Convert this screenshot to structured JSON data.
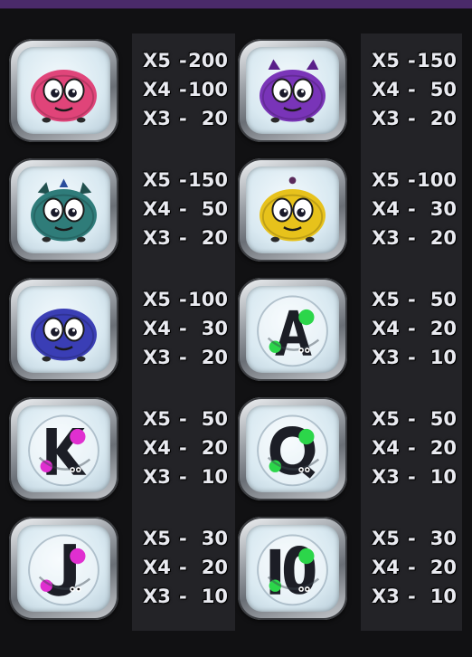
{
  "colors": {
    "background": "#111113",
    "column": "#232327",
    "topbar": "#4a2a6a",
    "text": "#e9eaf0"
  },
  "paytable": [
    {
      "symbol": "pink-monster-icon",
      "color": "#e0457a",
      "rows": [
        {
          "mult": "X5",
          "dash": "-",
          "value": "200"
        },
        {
          "mult": "X4",
          "dash": "-",
          "value": "100"
        },
        {
          "mult": "X3",
          "dash": "-",
          "value": "20"
        }
      ]
    },
    {
      "symbol": "purple-monster-icon",
      "color": "#7a35b8",
      "rows": [
        {
          "mult": "X5",
          "dash": "-",
          "value": "150"
        },
        {
          "mult": "X4",
          "dash": "-",
          "value": "50"
        },
        {
          "mult": "X3",
          "dash": "-",
          "value": "20"
        }
      ]
    },
    {
      "symbol": "teal-dragon-monster-icon",
      "color": "#2f7c7a",
      "rows": [
        {
          "mult": "X5",
          "dash": "-",
          "value": "150"
        },
        {
          "mult": "X4",
          "dash": "-",
          "value": "50"
        },
        {
          "mult": "X3",
          "dash": "-",
          "value": "20"
        }
      ]
    },
    {
      "symbol": "yellow-monster-icon",
      "color": "#e7c21c",
      "rows": [
        {
          "mult": "X5",
          "dash": "-",
          "value": "100"
        },
        {
          "mult": "X4",
          "dash": "-",
          "value": "30"
        },
        {
          "mult": "X3",
          "dash": "-",
          "value": "20"
        }
      ]
    },
    {
      "symbol": "blue-monster-icon",
      "color": "#3b3fb5",
      "rows": [
        {
          "mult": "X5",
          "dash": "-",
          "value": "100"
        },
        {
          "mult": "X4",
          "dash": "-",
          "value": "30"
        },
        {
          "mult": "X3",
          "dash": "-",
          "value": "20"
        }
      ]
    },
    {
      "symbol": "letter-a-icon",
      "color": "#2cd64a",
      "rows": [
        {
          "mult": "X5",
          "dash": "-",
          "value": "50"
        },
        {
          "mult": "X4",
          "dash": "-",
          "value": "20"
        },
        {
          "mult": "X3",
          "dash": "-",
          "value": "10"
        }
      ]
    },
    {
      "symbol": "letter-k-icon",
      "color": "#e02fd0",
      "rows": [
        {
          "mult": "X5",
          "dash": "-",
          "value": "50"
        },
        {
          "mult": "X4",
          "dash": "-",
          "value": "20"
        },
        {
          "mult": "X3",
          "dash": "-",
          "value": "10"
        }
      ]
    },
    {
      "symbol": "letter-q-icon",
      "color": "#2cd64a",
      "rows": [
        {
          "mult": "X5",
          "dash": "-",
          "value": "50"
        },
        {
          "mult": "X4",
          "dash": "-",
          "value": "20"
        },
        {
          "mult": "X3",
          "dash": "-",
          "value": "10"
        }
      ]
    },
    {
      "symbol": "letter-j-icon",
      "color": "#e02fd0",
      "rows": [
        {
          "mult": "X5",
          "dash": "-",
          "value": "30"
        },
        {
          "mult": "X4",
          "dash": "-",
          "value": "20"
        },
        {
          "mult": "X3",
          "dash": "-",
          "value": "10"
        }
      ]
    },
    {
      "symbol": "number-10-icon",
      "color": "#2cd64a",
      "rows": [
        {
          "mult": "X5",
          "dash": "-",
          "value": "30"
        },
        {
          "mult": "X4",
          "dash": "-",
          "value": "20"
        },
        {
          "mult": "X3",
          "dash": "-",
          "value": "10"
        }
      ]
    }
  ]
}
